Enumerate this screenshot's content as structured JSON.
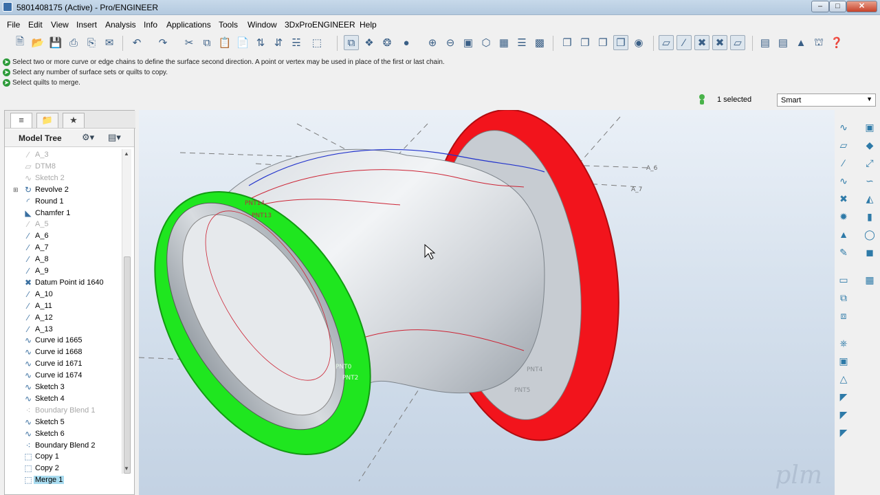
{
  "window": {
    "title": "5801408175 (Active) - Pro/ENGINEER"
  },
  "menu": [
    "File",
    "Edit",
    "View",
    "Insert",
    "Analysis",
    "Info",
    "Applications",
    "Tools",
    "Window",
    "3DxProENGINEER",
    "Help"
  ],
  "toolbar_icons": [
    "new-icon",
    "open-icon",
    "save-icon",
    "print-icon",
    "print-preview-icon",
    "email-icon",
    "undo-icon",
    "redo-icon",
    "cut-icon",
    "copy-icon",
    "paste-icon",
    "paste-special-icon",
    "regenerate-icon",
    "regen-manager-icon",
    "find-icon",
    "select-box-icon",
    "repaint-icon",
    "datum-display-icon",
    "spin-center-icon",
    "shading-icon",
    "zoom-in-icon",
    "zoom-out-icon",
    "refit-icon",
    "orient-icon",
    "saved-views-icon",
    "layers-icon",
    "wireframe-icon",
    "hidden-line-icon",
    "no-hidden-icon",
    "shaded-icon",
    "appearance-icon",
    "datum-plane-icon",
    "datum-axis-icon",
    "datum-point-icon",
    "coord-sys-icon",
    "annotation-icon",
    "mapkey-icon",
    "measure-icon",
    "section-icon",
    "sketcher-icon",
    "context-help-icon"
  ],
  "messages": [
    "Select two or more curve or edge chains to define the surface second direction. A point or vertex may be used in place of the first or last chain.",
    "Select any number of surface sets or quilts to copy.",
    "Select quilts to merge."
  ],
  "status": {
    "selected": "1 selected",
    "filter": "Smart"
  },
  "model_tree": {
    "title": "Model Tree",
    "items": [
      {
        "label": "A_3",
        "icon": "datum-axis-icon",
        "dim": true
      },
      {
        "label": "DTM8",
        "icon": "datum-plane-icon",
        "dim": true
      },
      {
        "label": "Sketch 2",
        "icon": "sketch-icon",
        "dim": true
      },
      {
        "label": "Revolve 2",
        "icon": "revolve-icon",
        "dim": false,
        "expand": true
      },
      {
        "label": "Round 1",
        "icon": "round-icon",
        "dim": false
      },
      {
        "label": "Chamfer 1",
        "icon": "chamfer-icon",
        "dim": false
      },
      {
        "label": "A_5",
        "icon": "datum-axis-icon",
        "dim": true
      },
      {
        "label": "A_6",
        "icon": "datum-axis-icon",
        "dim": false
      },
      {
        "label": "A_7",
        "icon": "datum-axis-icon",
        "dim": false
      },
      {
        "label": "A_8",
        "icon": "datum-axis-icon",
        "dim": false
      },
      {
        "label": "A_9",
        "icon": "datum-axis-icon",
        "dim": false
      },
      {
        "label": "Datum Point id 1640",
        "icon": "datum-point-icon",
        "dim": false
      },
      {
        "label": "A_10",
        "icon": "datum-axis-icon",
        "dim": false
      },
      {
        "label": "A_11",
        "icon": "datum-axis-icon",
        "dim": false
      },
      {
        "label": "A_12",
        "icon": "datum-axis-icon",
        "dim": false
      },
      {
        "label": "A_13",
        "icon": "datum-axis-icon",
        "dim": false
      },
      {
        "label": "Curve id 1665",
        "icon": "curve-icon",
        "dim": false
      },
      {
        "label": "Curve id 1668",
        "icon": "curve-icon",
        "dim": false
      },
      {
        "label": "Curve id 1671",
        "icon": "curve-icon",
        "dim": false
      },
      {
        "label": "Curve id 1674",
        "icon": "curve-icon",
        "dim": false
      },
      {
        "label": "Sketch 3",
        "icon": "sketch-icon",
        "dim": false
      },
      {
        "label": "Sketch 4",
        "icon": "sketch-icon",
        "dim": false
      },
      {
        "label": "Boundary Blend 1",
        "icon": "boundary-blend-icon",
        "dim": true
      },
      {
        "label": "Sketch 5",
        "icon": "sketch-icon",
        "dim": false
      },
      {
        "label": "Sketch 6",
        "icon": "sketch-icon",
        "dim": false
      },
      {
        "label": "Boundary Blend 2",
        "icon": "boundary-blend-icon",
        "dim": false
      },
      {
        "label": "Copy 1",
        "icon": "copy-quilt-icon",
        "dim": false
      },
      {
        "label": "Copy 2",
        "icon": "copy-quilt-icon",
        "dim": false
      },
      {
        "label": "Merge 1",
        "icon": "merge-icon",
        "dim": false,
        "selected": true
      }
    ]
  },
  "viewport_labels": {
    "axis_a6": "A_6",
    "axis_a7": "A_7",
    "pnt_top1": "PNT14",
    "pnt_top2": "PNT13",
    "pnt_mid1": "PNT0",
    "pnt_mid2": "PNT2",
    "pnt_low1": "PNT4",
    "pnt_low2": "PNT5"
  },
  "watermark": "plm",
  "colors": {
    "green_flange": "#1fe61f",
    "red_flange": "#f2141c",
    "pipe": "#c9ced4",
    "viewport_bg": "#d7e2ee"
  },
  "right_tools": [
    "boundary-blend-tool-icon",
    "plane-tool-icon",
    "axis-tool-icon",
    "curve-tool-icon",
    "point-tool-icon",
    "csys-tool-icon",
    "offset-tool-icon",
    "sketch-tool-icon",
    "fill-tool-icon",
    "copy-tool-icon",
    "merge-tool-icon",
    "trim-tool-icon",
    "extend-tool-icon",
    "thicken-tool-icon",
    "revolve-tool-icon",
    "sweep-tool-icon",
    "blend-tool-icon",
    "extrude-tool-icon",
    "style-tool-icon",
    "round-tool-icon",
    "mirror-tool-icon",
    "pattern-tool-icon"
  ]
}
